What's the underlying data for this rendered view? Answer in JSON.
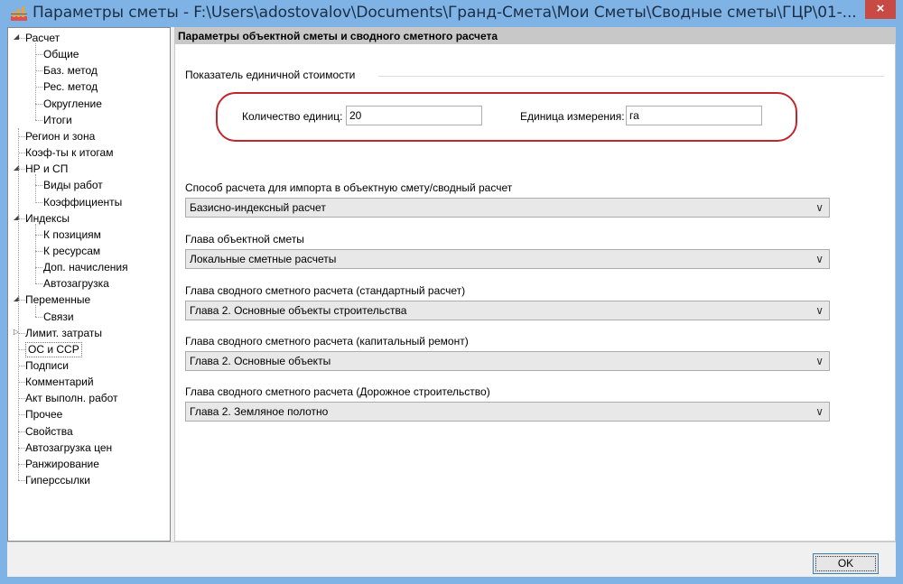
{
  "window": {
    "title": "Параметры сметы - F:\\Users\\adostovalov\\Documents\\Гранд-Смета\\Мои Сметы\\Сводные сметы\\ГЦР\\01-...",
    "close_label": "×"
  },
  "tree": {
    "items": [
      {
        "label": "Расчет",
        "level": 0,
        "expanded": true
      },
      {
        "label": "Общие",
        "level": 1
      },
      {
        "label": "Баз. метод",
        "level": 1
      },
      {
        "label": "Рес. метод",
        "level": 1
      },
      {
        "label": "Округление",
        "level": 1
      },
      {
        "label": "Итоги",
        "level": 1
      },
      {
        "label": "Регион и зона",
        "level": 0
      },
      {
        "label": "Коэф-ты к итогам",
        "level": 0
      },
      {
        "label": "НР и СП",
        "level": 0,
        "expanded": true
      },
      {
        "label": "Виды работ",
        "level": 1
      },
      {
        "label": "Коэффициенты",
        "level": 1
      },
      {
        "label": "Индексы",
        "level": 0,
        "expanded": true
      },
      {
        "label": "К позициям",
        "level": 1
      },
      {
        "label": "К ресурсам",
        "level": 1
      },
      {
        "label": "Доп. начисления",
        "level": 1
      },
      {
        "label": "Автозагрузка",
        "level": 1
      },
      {
        "label": "Переменные",
        "level": 0,
        "expanded": true
      },
      {
        "label": "Связи",
        "level": 1
      },
      {
        "label": "Лимит. затраты",
        "level": 0,
        "expanded": false
      },
      {
        "label": "ОС и ССР",
        "level": 0,
        "selected": true
      },
      {
        "label": "Подписи",
        "level": 0
      },
      {
        "label": "Комментарий",
        "level": 0
      },
      {
        "label": "Акт выполн. работ",
        "level": 0
      },
      {
        "label": "Прочее",
        "level": 0
      },
      {
        "label": "Свойства",
        "level": 0
      },
      {
        "label": "Автозагрузка цен",
        "level": 0
      },
      {
        "label": "Ранжирование",
        "level": 0
      },
      {
        "label": "Гиперссылки",
        "level": 0
      }
    ]
  },
  "panel": {
    "header": "Параметры объектной сметы и сводного сметного расчета",
    "unit_group": {
      "caption": "Показатель единичной стоимости",
      "qty_label": "Количество единиц:",
      "qty_value": "20",
      "unit_label": "Единица измерения:",
      "unit_value": "га"
    },
    "combos": [
      {
        "label": "Способ расчета для импорта в объектную смету/сводный расчет",
        "value": "Базисно-индексный расчет"
      },
      {
        "label": "Глава объектной сметы",
        "value": "Локальные сметные расчеты"
      },
      {
        "label": "Глава сводного сметного расчета (стандартный расчет)",
        "value": "Глава 2. Основные объекты строительства"
      },
      {
        "label": "Глава сводного сметного расчета (капитальный ремонт)",
        "value": "Глава 2. Основные объекты"
      },
      {
        "label": "Глава сводного сметного расчета (Дорожное строительство)",
        "value": "Глава 2. Земляное полотно"
      }
    ]
  },
  "footer": {
    "ok_label": "OK"
  }
}
